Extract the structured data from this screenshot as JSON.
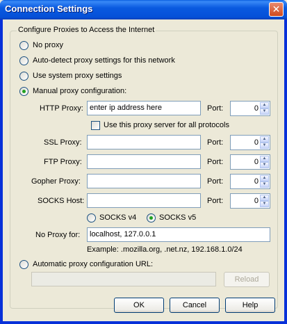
{
  "window": {
    "title": "Connection Settings",
    "close_glyph": "✕"
  },
  "group": {
    "legend": "Configure Proxies to Access the Internet"
  },
  "modes": {
    "no_proxy": "No proxy",
    "auto_detect": "Auto-detect proxy settings for this network",
    "system": "Use system proxy settings",
    "manual": "Manual proxy configuration:",
    "auto_url": "Automatic proxy configuration URL:",
    "selected": "manual"
  },
  "manual": {
    "http_label": "HTTP Proxy:",
    "http_value": "enter ip address here",
    "port_label": "Port:",
    "http_port": "0",
    "use_all_label": "Use this proxy server for all protocols",
    "ssl_label": "SSL Proxy:",
    "ssl_value": "",
    "ssl_port": "0",
    "ftp_label": "FTP Proxy:",
    "ftp_value": "",
    "ftp_port": "0",
    "gopher_label": "Gopher Proxy:",
    "gopher_value": "",
    "gopher_port": "0",
    "socks_label": "SOCKS Host:",
    "socks_value": "",
    "socks_port": "0",
    "socks_v4": "SOCKS v4",
    "socks_v5": "SOCKS v5",
    "no_proxy_label": "No Proxy for:",
    "no_proxy_value": "localhost, 127.0.0.1",
    "example": "Example: .mozilla.org, .net.nz, 192.168.1.0/24"
  },
  "auto_url_value": "",
  "buttons": {
    "reload": "Reload",
    "ok": "OK",
    "cancel": "Cancel",
    "help": "Help"
  },
  "colors": {
    "title_bar": "#0a5ae0",
    "dialog_bg": "#ece9d8",
    "radio_dot": "#21a121"
  }
}
